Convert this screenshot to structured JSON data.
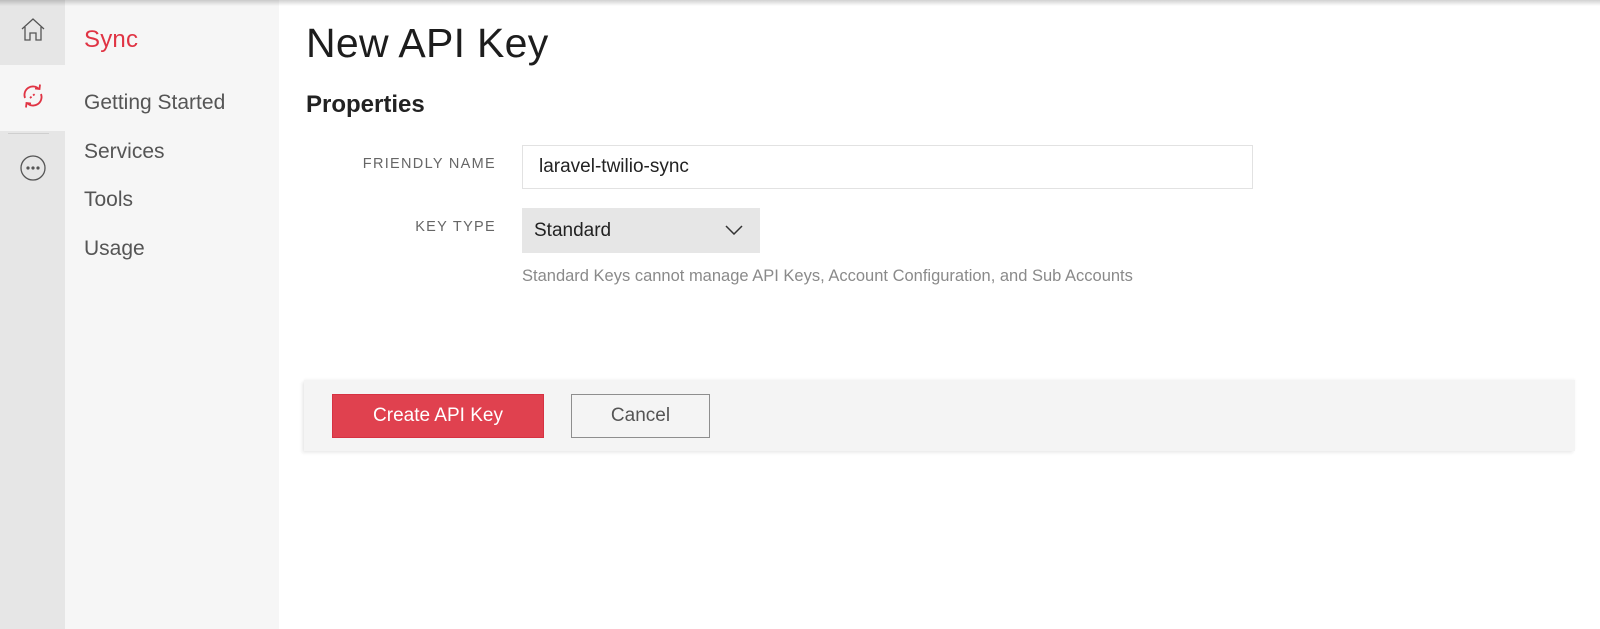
{
  "rail": {
    "items": [
      {
        "name": "home",
        "icon": "home-icon",
        "active": false
      },
      {
        "name": "sync",
        "icon": "sync-icon",
        "active": true
      },
      {
        "name": "more",
        "icon": "more-icon",
        "active": false
      }
    ]
  },
  "nav": {
    "title": "Sync",
    "items": [
      {
        "label": "Getting Started"
      },
      {
        "label": "Services"
      },
      {
        "label": "Tools"
      },
      {
        "label": "Usage"
      }
    ]
  },
  "page": {
    "title": "New API Key",
    "section_title": "Properties"
  },
  "form": {
    "friendly_name": {
      "label": "FRIENDLY NAME",
      "value": "laravel-twilio-sync"
    },
    "key_type": {
      "label": "KEY TYPE",
      "selected": "Standard",
      "help": "Standard Keys cannot manage API Keys, Account Configuration, and Sub Accounts"
    }
  },
  "actions": {
    "create_label": "Create API Key",
    "cancel_label": "Cancel"
  },
  "colors": {
    "accent": "#e0414f",
    "brand_red": "#e03444",
    "rail_bg": "#e6e6e6",
    "nav_bg": "#f6f6f6"
  }
}
